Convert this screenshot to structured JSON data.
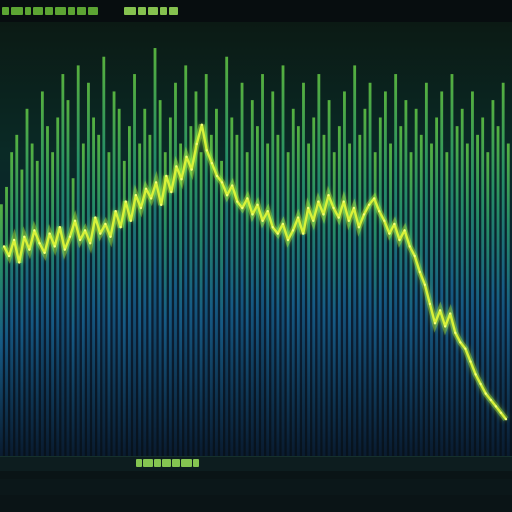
{
  "app": {
    "background": "#081012",
    "bar_color_top": "#5fd03a",
    "bar_color_bottom": "#0a2a4a",
    "line_color": "#d8f23a",
    "glow_color": "#b8ff3a"
  },
  "top_bar": {
    "icons": [
      "status-glyph-group-left",
      "status-glyph-group-right"
    ]
  },
  "bottom_strip": {
    "icons": [
      "scrubber-glyph-group"
    ]
  },
  "chart_data": {
    "type": "line",
    "x": [
      0,
      1,
      2,
      3,
      4,
      5,
      6,
      7,
      8,
      9,
      10,
      11,
      12,
      13,
      14,
      15,
      16,
      17,
      18,
      19,
      20,
      21,
      22,
      23,
      24,
      25,
      26,
      27,
      28,
      29,
      30,
      31,
      32,
      33,
      34,
      35,
      36,
      37,
      38,
      39,
      40,
      41,
      42,
      43,
      44,
      45,
      46,
      47,
      48,
      49,
      50,
      51,
      52,
      53,
      54,
      55,
      56,
      57,
      58,
      59,
      60,
      61,
      62,
      63,
      64,
      65,
      66,
      67,
      68,
      69,
      70,
      71,
      72,
      73,
      74,
      75,
      76,
      77,
      78,
      79,
      80,
      81,
      82,
      83,
      84,
      85,
      86,
      87,
      88,
      89,
      90,
      91,
      92,
      93,
      94,
      95,
      96,
      97,
      98,
      99
    ],
    "series": [
      {
        "values": [
          58,
          55,
          60,
          53,
          61,
          57,
          63,
          59,
          56,
          62,
          58,
          64,
          57,
          61,
          66,
          60,
          63,
          59,
          67,
          62,
          65,
          61,
          69,
          64,
          72,
          66,
          74,
          70,
          76,
          73,
          78,
          71,
          80,
          75,
          83,
          79,
          86,
          82,
          90,
          96,
          88,
          84,
          80,
          78,
          74,
          77,
          72,
          70,
          73,
          68,
          71,
          66,
          69,
          64,
          62,
          65,
          60,
          63,
          67,
          62,
          70,
          66,
          72,
          68,
          74,
          70,
          67,
          72,
          66,
          70,
          64,
          68,
          71,
          73,
          69,
          66,
          62,
          65,
          60,
          63,
          58,
          55,
          50,
          46,
          40,
          34,
          38,
          33,
          37,
          31,
          28,
          26,
          22,
          18,
          15,
          12,
          10,
          8,
          6,
          4
        ]
      }
    ],
    "bars": [
      58,
      62,
      70,
      74,
      66,
      80,
      72,
      68,
      84,
      76,
      70,
      78,
      88,
      82,
      64,
      90,
      72,
      86,
      78,
      74,
      92,
      70,
      84,
      80,
      68,
      76,
      88,
      72,
      80,
      74,
      94,
      82,
      70,
      78,
      86,
      72,
      90,
      76,
      84,
      70,
      88,
      74,
      80,
      68,
      92,
      78,
      74,
      86,
      70,
      82,
      76,
      88,
      72,
      84,
      74,
      90,
      70,
      80,
      76,
      86,
      72,
      78,
      88,
      74,
      82,
      70,
      76,
      84,
      72,
      90,
      74,
      80,
      86,
      70,
      78,
      84,
      72,
      88,
      76,
      82,
      70,
      80,
      74,
      86,
      72,
      78,
      84,
      70,
      88,
      76,
      80,
      72,
      84,
      74,
      78,
      70,
      82,
      76,
      86,
      72
    ],
    "ylim": [
      0,
      100
    ],
    "grid": false
  }
}
